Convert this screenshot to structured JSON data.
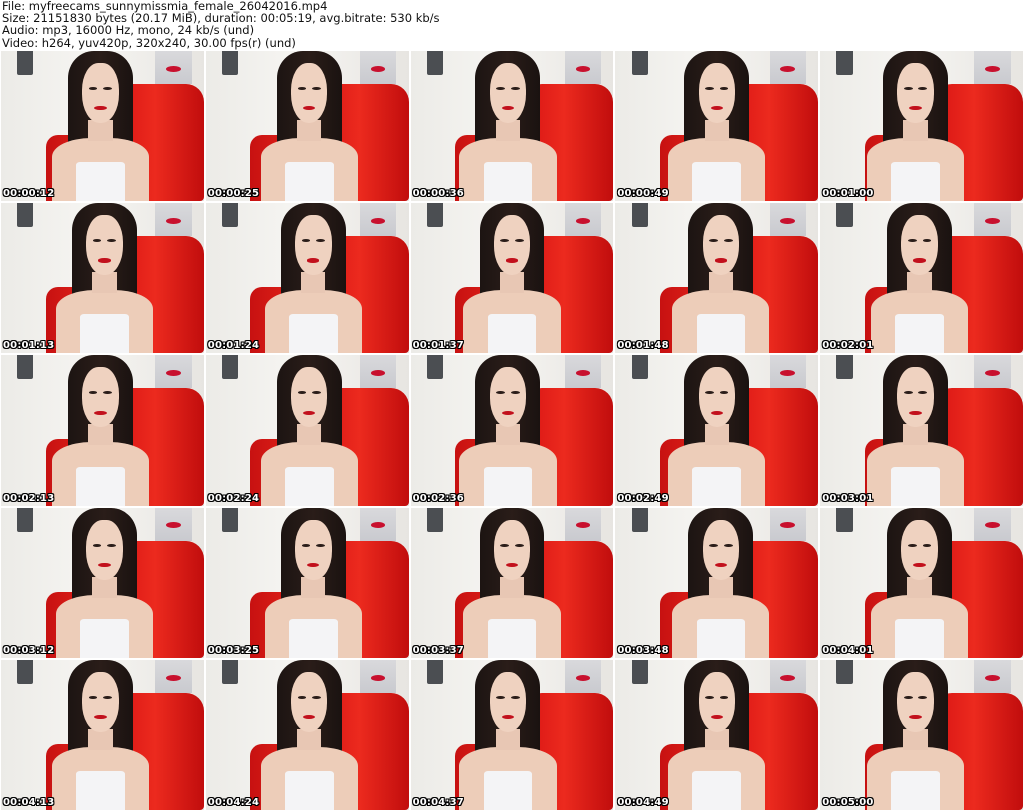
{
  "header": {
    "file": "File: myfreecams_sunnymissmia_female_26042016.mp4",
    "size": "Size: 21151830 bytes (20.17 MiB), duration: 00:05:19, avg.bitrate: 530 kb/s",
    "audio": "Audio: mp3, 16000 Hz, mono, 24 kb/s (und)",
    "video": "Video: h264, yuv420p, 320x240, 30.00 fps(r) (und)"
  },
  "colors": {
    "chair_red": "#e3201a",
    "lipstick": "#c2101c",
    "hair": "#1c1412",
    "wall": "#efeeea",
    "timestamp_text": "#ffffff"
  },
  "thumbnails": [
    {
      "timestamp": "00:00:12"
    },
    {
      "timestamp": "00:00:25"
    },
    {
      "timestamp": "00:00:36"
    },
    {
      "timestamp": "00:00:49"
    },
    {
      "timestamp": "00:01:00"
    },
    {
      "timestamp": "00:01:13"
    },
    {
      "timestamp": "00:01:24"
    },
    {
      "timestamp": "00:01:37"
    },
    {
      "timestamp": "00:01:48"
    },
    {
      "timestamp": "00:02:01"
    },
    {
      "timestamp": "00:02:13"
    },
    {
      "timestamp": "00:02:24"
    },
    {
      "timestamp": "00:02:36"
    },
    {
      "timestamp": "00:02:49"
    },
    {
      "timestamp": "00:03:01"
    },
    {
      "timestamp": "00:03:12"
    },
    {
      "timestamp": "00:03:25"
    },
    {
      "timestamp": "00:03:37"
    },
    {
      "timestamp": "00:03:48"
    },
    {
      "timestamp": "00:04:01"
    },
    {
      "timestamp": "00:04:13"
    },
    {
      "timestamp": "00:04:24"
    },
    {
      "timestamp": "00:04:37"
    },
    {
      "timestamp": "00:04:49"
    },
    {
      "timestamp": "00:05:00"
    }
  ]
}
